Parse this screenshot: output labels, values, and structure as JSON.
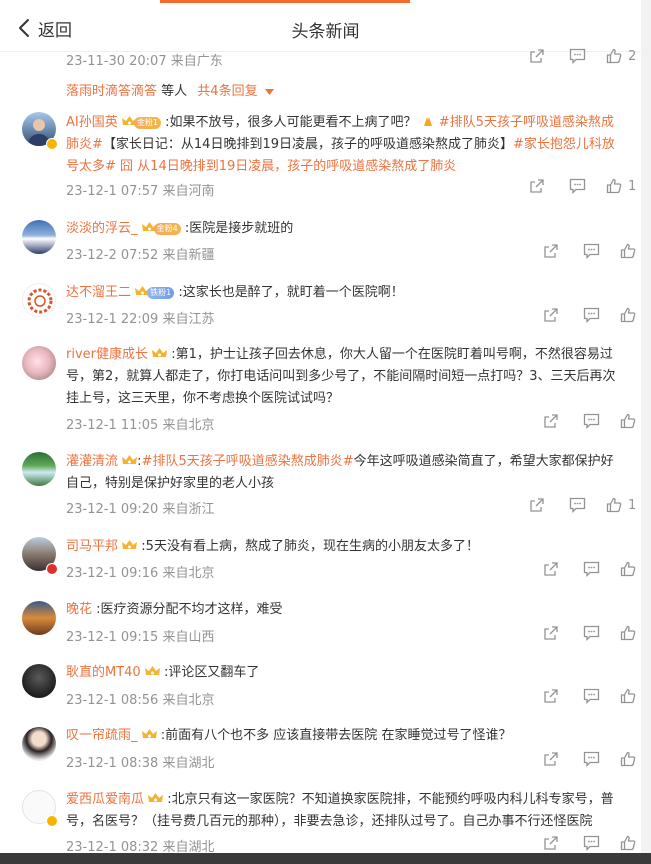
{
  "header": {
    "back_label": "返回",
    "title": "头条新闻"
  },
  "top": {
    "meta": "23-11-30 20:07 来自广东",
    "like_count": "2",
    "sub_reply": {
      "name": "落雨时滴答滴答",
      "text": " 等人",
      "more": "共4条回复"
    }
  },
  "comments": [
    {
      "name": "AI孙国英",
      "badge": "金粉1",
      "text_a": ":如果不放号，很多人可能更看不上病了吧？",
      "topic1": "#排队5天孩子呼吸道感染熬成肺炎#",
      "text_b": "【家长日记：从14日晚排到19日凌晨，孩子的呼吸道感染熬成了肺炎】",
      "topic2": "#家长抱怨儿科放号太多#",
      "topic3": "囧 从14日晚排到19日凌晨，孩子的呼吸道感染熬成了肺炎",
      "meta": "23-12-1 07:57 来自河南",
      "likes": "1"
    },
    {
      "name": "淡淡的浮云_",
      "badge": "金粉4",
      "text": ":医院是接步就班的",
      "meta": "23-12-2 07:52 来自新疆",
      "likes": ""
    },
    {
      "name": "达不溜王二",
      "badge": "铁粉1",
      "text": ":这家长也是醉了，就盯着一个医院啊！",
      "meta": "23-12-1 22:09 来自江苏",
      "likes": ""
    },
    {
      "name": "river健康成长",
      "text": ":第1，护士让孩子回去休息，你大人留一个在医院盯着叫号啊，不然很容易过号，第2，就算人都走了，你打电话问叫到多少号了，不能间隔时间短一点打吗？3、三天后再次挂上号，这三天里，你不考虑换个医院试试吗？",
      "meta": "23-12-1 11:05 来自北京",
      "likes": ""
    },
    {
      "name": "灌灌清流",
      "topic": "#排队5天孩子呼吸道感染熬成肺炎#",
      "text": "今年这呼吸道感染简直了，希望大家都保护好自己，特别是保护好家里的老人小孩",
      "meta": "23-12-1 09:20 来自浙江",
      "likes": "1"
    },
    {
      "name": "司马平邦",
      "text": ":5天没有看上病，熬成了肺炎，现在生病的小朋友太多了！",
      "meta": "23-12-1 09:16 来自北京",
      "likes": ""
    },
    {
      "name": "晚花",
      "text": ":医疗资源分配不均才这样，难受",
      "meta": "23-12-1 09:15 来自山西",
      "likes": ""
    },
    {
      "name": "耿直的MT40",
      "text": ":评论区又翻车了",
      "meta": "23-12-1 08:56 来自北京",
      "likes": ""
    },
    {
      "name": "叹一帘疏雨_",
      "text": ":前面有八个也不多 应该直接带去医院 在家睡觉过号了怪谁？",
      "meta": "23-12-1 08:38 来自湖北",
      "likes": ""
    },
    {
      "name": "爱西瓜爱南瓜",
      "text": ":北京只有这一家医院？不知道换家医院排，不能预约呼吸内科儿科专家号，普号，名医号？（挂号费几百元的那种），非要去急诊，还排队过号了。自己办事不行还怪医院",
      "meta": "23-12-1 08:32 来自湖北",
      "likes": ""
    }
  ],
  "icons": {
    "share": "share-icon",
    "comment": "comment-icon",
    "like": "like-icon",
    "back": "back-chevron-icon",
    "expand": "caret-down-icon",
    "vip_crown": "crown-icon"
  },
  "colors": {
    "accent": "#eb7340",
    "meta_text": "#939393",
    "verified": "#f7b500"
  }
}
